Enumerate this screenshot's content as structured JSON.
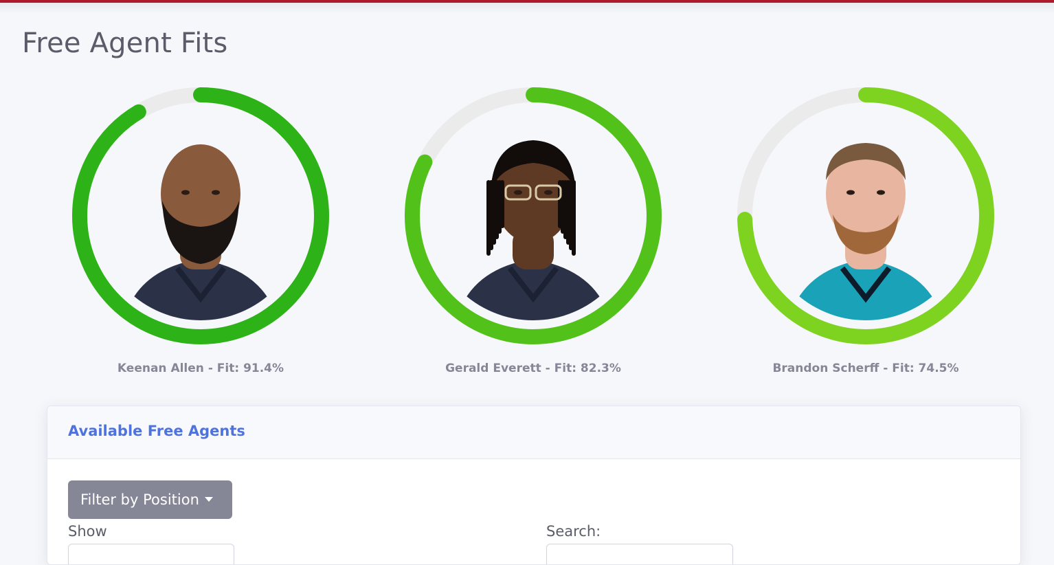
{
  "page": {
    "title": "Free Agent Fits"
  },
  "fits": [
    {
      "name": "Keenan Allen",
      "fit": 91.4,
      "label": "Keenan Allen - Fit: 91.4%",
      "color": "#2db317",
      "jersey": "#2b3247",
      "skin": "#8a5a3c",
      "hair": "beard"
    },
    {
      "name": "Gerald Everett",
      "fit": 82.3,
      "label": "Gerald Everett - Fit: 82.3%",
      "color": "#52c21a",
      "jersey": "#2b3247",
      "skin": "#5e3a24",
      "hair": "locs"
    },
    {
      "name": "Brandon Scherff",
      "fit": 74.5,
      "label": "Brandon Scherff - Fit: 74.5%",
      "color": "#7ed321",
      "jersey": "#1aa3b8",
      "skin": "#e8b6a0",
      "hair": "short"
    }
  ],
  "ring_track_color": "#ebebeb",
  "free_agents": {
    "title": "Available Free Agents",
    "filter_label": "Filter by Position",
    "show_label": "Show",
    "search_label": "Search:"
  }
}
